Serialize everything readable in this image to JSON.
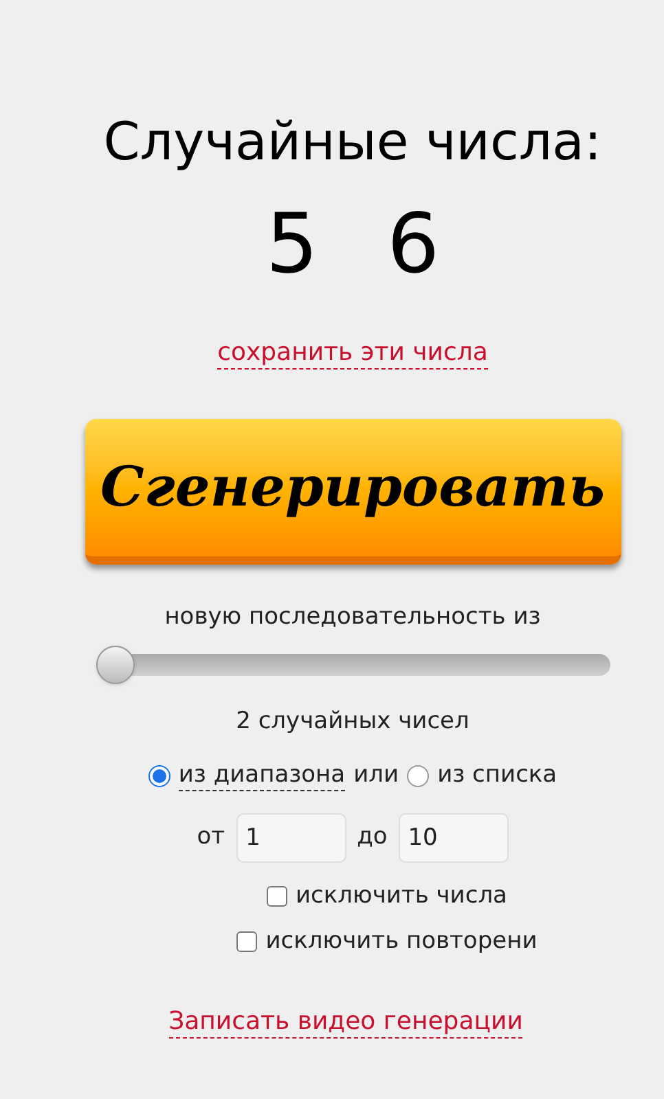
{
  "heading": "Случайные числа:",
  "numbers": [
    "5",
    "6"
  ],
  "save_link": "сохранить эти числа",
  "generate_button": "Сгенерировать",
  "count_label": "новую последовательность из",
  "count_slider": {
    "level": 0
  },
  "count_reading": "2 случайных чисел",
  "source_options": [
    {
      "label": "из диапазона",
      "selected": true,
      "underlined": true
    },
    {
      "label": "из списка",
      "selected": false,
      "underlined": false
    }
  ],
  "or_text": "или",
  "range": {
    "from_label": "от",
    "from_value": "1",
    "to_label": "до",
    "to_value": "10"
  },
  "options": [
    {
      "label": "исключить числа",
      "checked": false
    },
    {
      "label": "исключить повторени",
      "checked": false
    }
  ],
  "record_link": "Записать видео генерации"
}
